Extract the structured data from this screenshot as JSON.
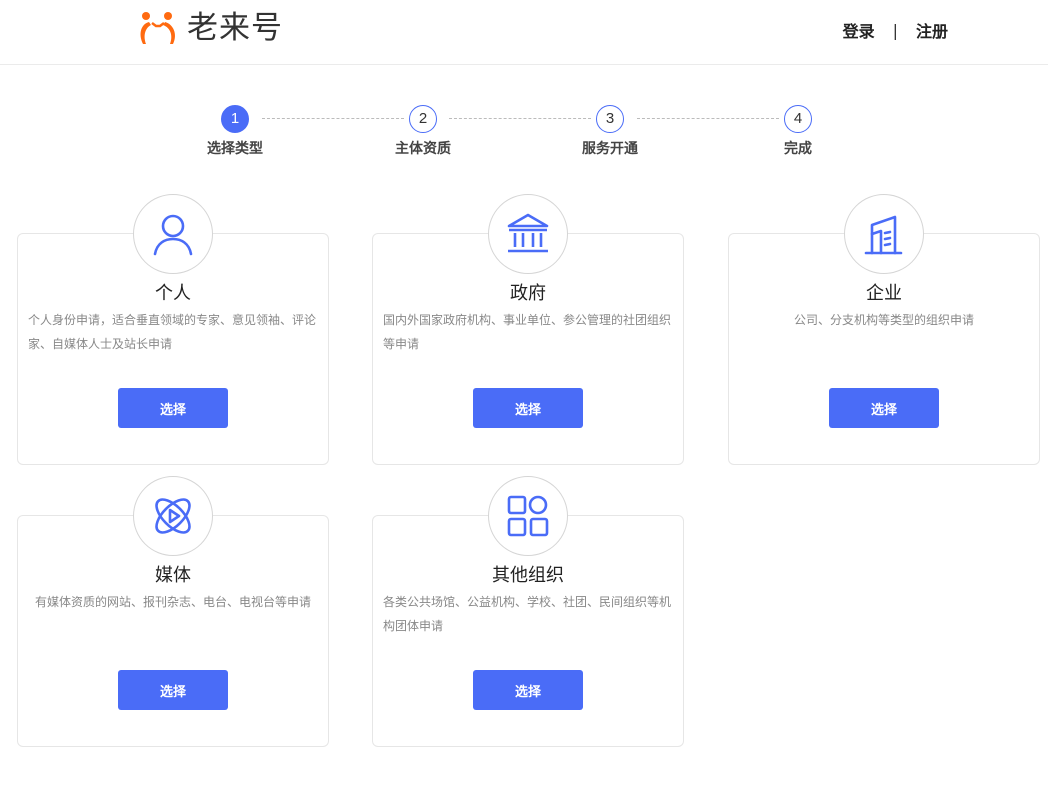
{
  "header": {
    "logo_text": "老来号",
    "login_label": "登录",
    "separator": "|",
    "register_label": "注册",
    "brand_color": "#ff6a10"
  },
  "steps": [
    {
      "number": "1",
      "label": "选择类型",
      "active": true
    },
    {
      "number": "2",
      "label": "主体资质",
      "active": false
    },
    {
      "number": "3",
      "label": "服务开通",
      "active": false
    },
    {
      "number": "4",
      "label": "完成",
      "active": false
    }
  ],
  "accent_color": "#4a6cf7",
  "cards": [
    {
      "icon": "person-icon",
      "title": "个人",
      "desc": "个人身份申请，适合垂直领域的专家、意见领袖、评论家、自媒体人士及站长申请",
      "button": "选择"
    },
    {
      "icon": "government-building-icon",
      "title": "政府",
      "desc": "国内外国家政府机构、事业单位、参公管理的社团组织等申请",
      "button": "选择"
    },
    {
      "icon": "enterprise-building-icon",
      "title": "企业",
      "desc": "公司、分支机构等类型的组织申请",
      "button": "选择"
    },
    {
      "icon": "media-orbit-icon",
      "title": "媒体",
      "desc": "有媒体资质的网站、报刊杂志、电台、电视台等申请",
      "button": "选择"
    },
    {
      "icon": "grid-apps-icon",
      "title": "其他组织",
      "desc": "各类公共场馆、公益机构、学校、社团、民间组织等机构团体申请",
      "button": "选择"
    }
  ]
}
